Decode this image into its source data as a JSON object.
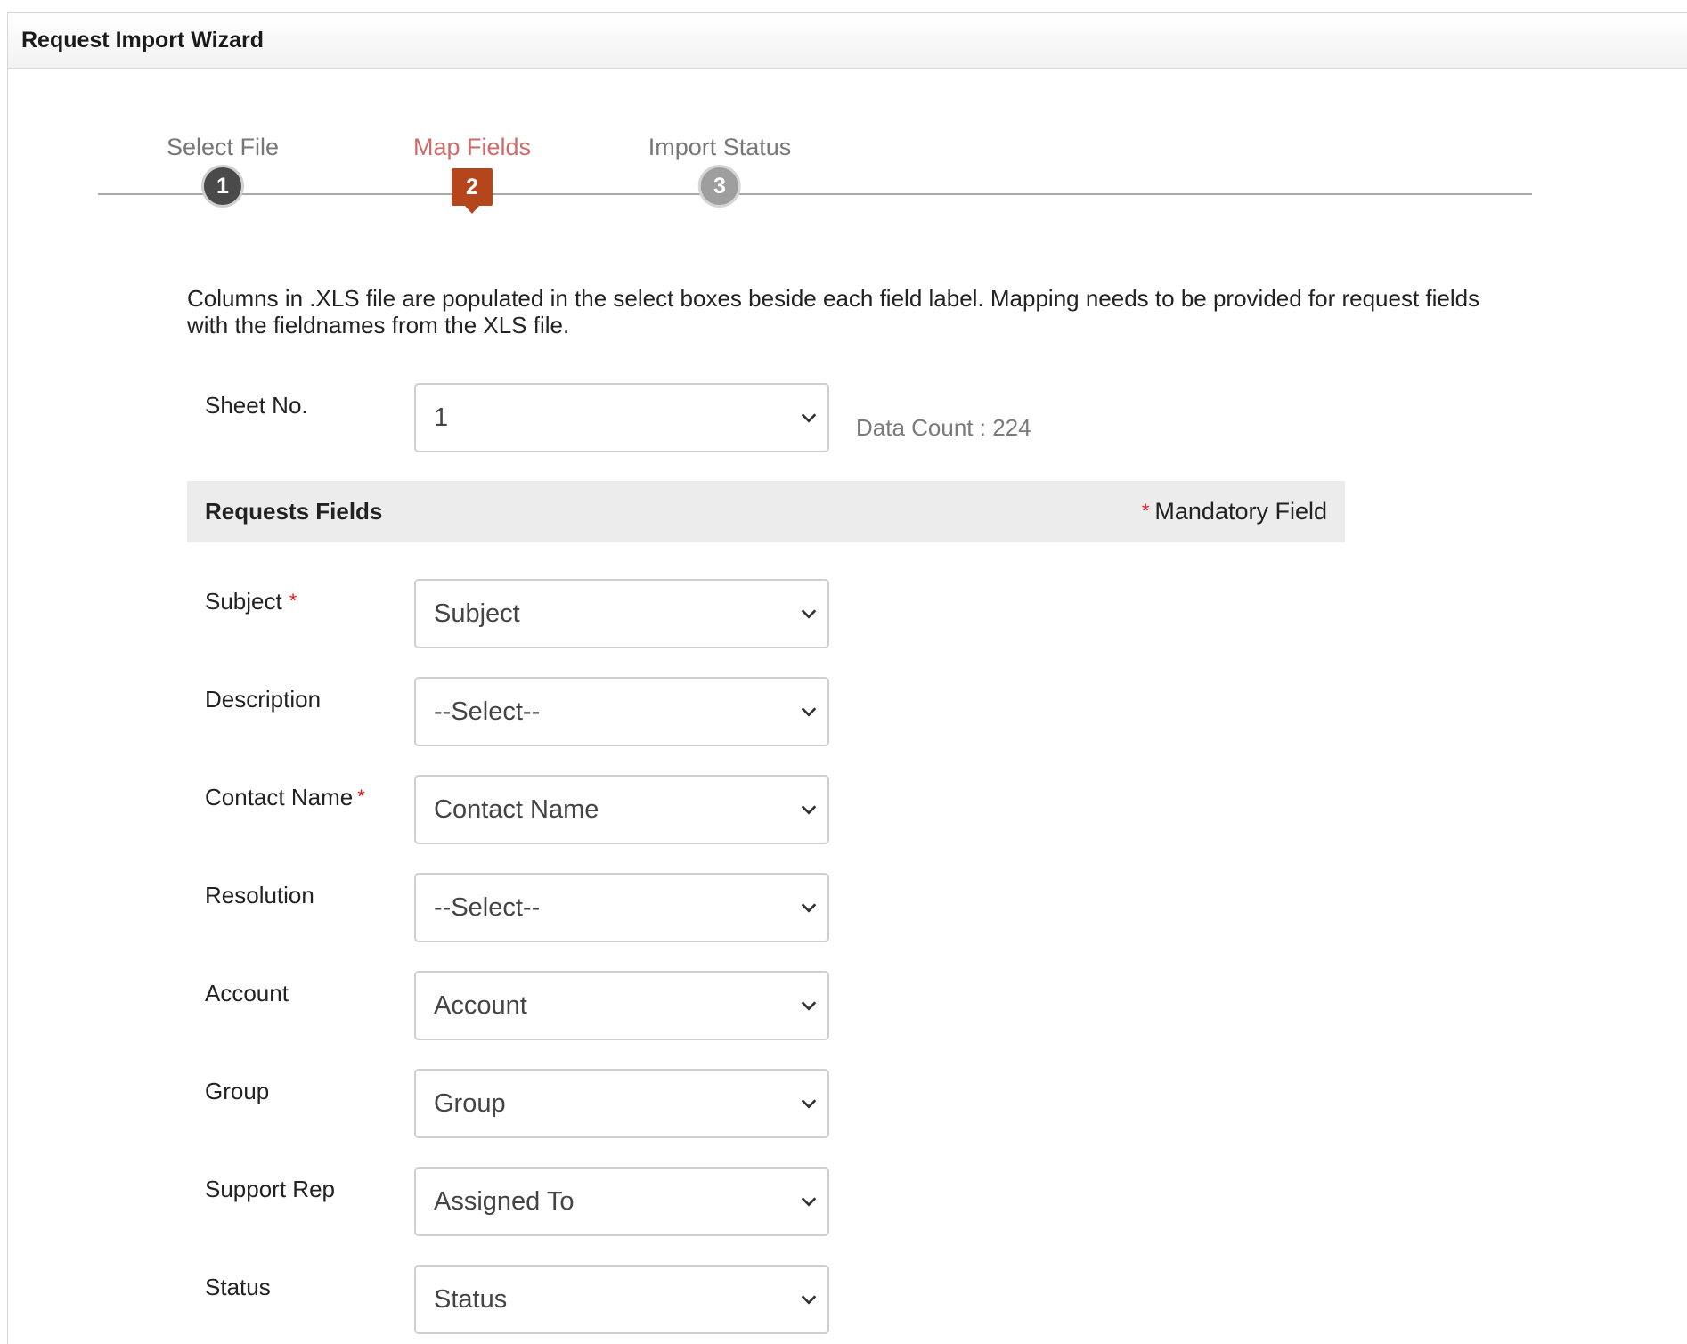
{
  "window": {
    "title": "Request Import Wizard"
  },
  "wizard": {
    "steps": [
      {
        "label": "Select File",
        "number": "1",
        "state": "done"
      },
      {
        "label": "Map Fields",
        "number": "2",
        "state": "active"
      },
      {
        "label": "Import Status",
        "number": "3",
        "state": "pending"
      }
    ]
  },
  "intro_text": "Columns in .XLS file are populated in the select boxes beside each field label. Mapping needs to be provided for request fields with the fieldnames from the XLS file.",
  "sheet": {
    "label": "Sheet No.",
    "value": "1",
    "data_count": "Data Count : 224"
  },
  "section": {
    "title": "Requests Fields",
    "mandatory_star": "*",
    "mandatory_label": "Mandatory Field"
  },
  "fields": [
    {
      "label": "Subject",
      "required": "*",
      "value": "Subject"
    },
    {
      "label": "Description",
      "value": "--Select--"
    },
    {
      "label": "Contact Name",
      "required": "*",
      "value": "Contact Name"
    },
    {
      "label": "Resolution",
      "value": "--Select--"
    },
    {
      "label": "Account",
      "value": "Account"
    },
    {
      "label": "Group",
      "value": "Group"
    },
    {
      "label": "Support Rep",
      "value": "Assigned To"
    },
    {
      "label": "Status",
      "value": "Status"
    }
  ],
  "colors": {
    "active_step": "#b5451b",
    "active_label": "#cf6a6a",
    "required": "#e01919"
  },
  "icons": {
    "select_arrow": "chevron-down-icon"
  }
}
